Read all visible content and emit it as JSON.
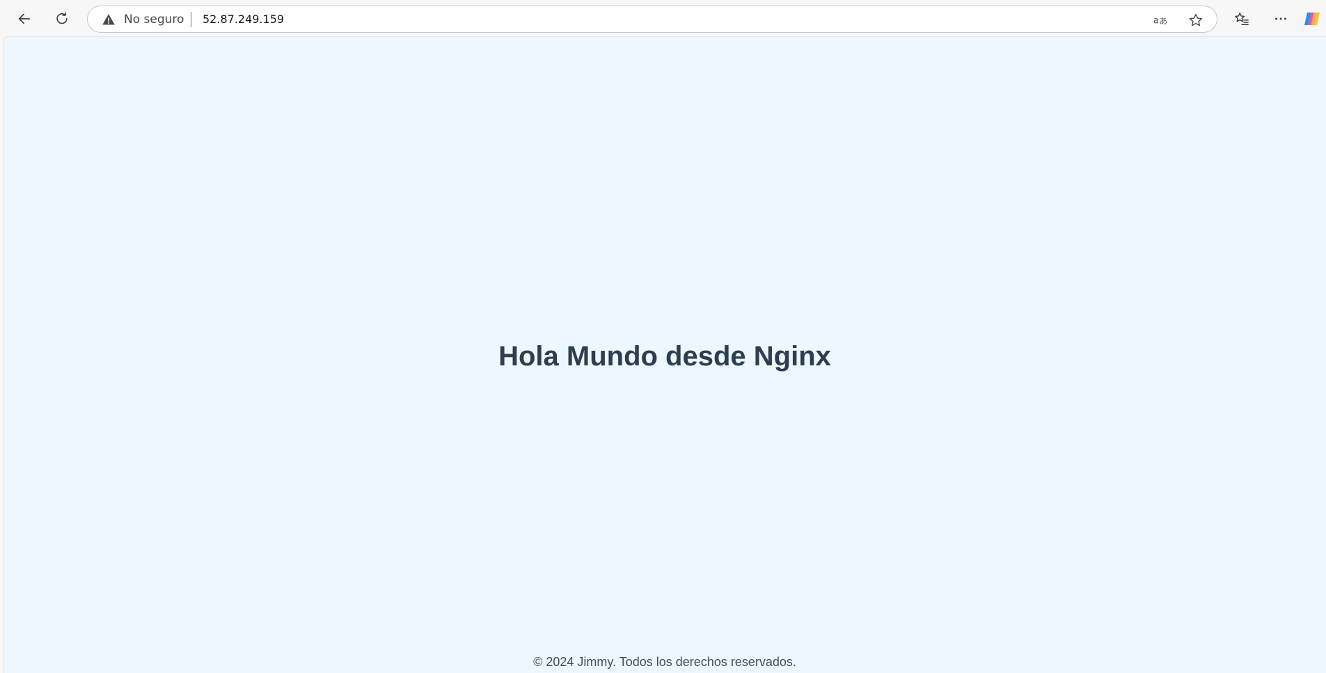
{
  "browser": {
    "back_icon": "back-arrow-icon",
    "refresh_icon": "refresh-icon",
    "address_bar": {
      "security_label": "No seguro",
      "security_icon": "warning-triangle-icon",
      "url": "52.87.249.159",
      "translate_icon": "translate-icon",
      "favorite_icon": "star-outline-icon"
    },
    "favorites_icon": "favorites-list-icon",
    "more_icon": "more-dots-icon",
    "copilot_icon": "copilot-icon"
  },
  "page": {
    "background": "#eef6fe",
    "heading": "Hola Mundo desde Nginx",
    "heading_color": "#2c3e50",
    "footer": "© 2024 Jimmy. Todos los derechos reservados."
  }
}
